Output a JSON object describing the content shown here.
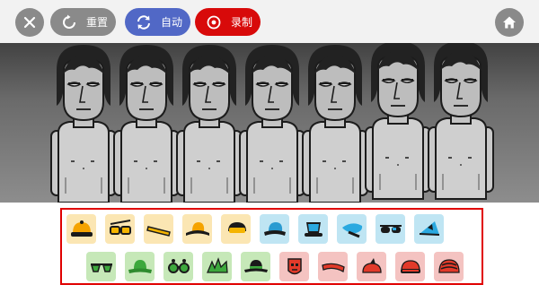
{
  "toolbar": {
    "reset_label": "重置",
    "auto_label": "自动",
    "record_label": "录制"
  },
  "colors": {
    "toolbar_bg": "#f2f2f2",
    "neutral_button": "#8a8a8a",
    "auto_button": "#5168c6",
    "record_button": "#d80a0a",
    "palette_border": "#e00000",
    "beats_tile": "#fbe6b3",
    "effects_tile": "#bfe5f3",
    "melodies_tile": "#c6e8b8",
    "voices_tile": "#f4c3c1"
  },
  "stage": {
    "character_count": 7
  },
  "palette": {
    "row1": [
      {
        "group": "beats",
        "icon": "yellow-cap-icon"
      },
      {
        "group": "beats",
        "icon": "yellow-sunglasses-icon"
      },
      {
        "group": "beats",
        "icon": "yellow-headband-icon"
      },
      {
        "group": "beats",
        "icon": "yellow-fedora-icon"
      },
      {
        "group": "beats",
        "icon": "yellow-visor-icon"
      },
      {
        "group": "effects",
        "icon": "blue-bowler-hat-icon"
      },
      {
        "group": "effects",
        "icon": "blue-top-hat-icon"
      },
      {
        "group": "effects",
        "icon": "blue-beret-icon"
      },
      {
        "group": "effects",
        "icon": "blue-sunglasses-icon"
      },
      {
        "group": "effects",
        "icon": "blue-pointy-cap-icon"
      }
    ],
    "row2": [
      {
        "group": "melodies",
        "icon": "green-sunglasses-icon"
      },
      {
        "group": "melodies",
        "icon": "green-hat-icon"
      },
      {
        "group": "melodies",
        "icon": "green-round-glasses-icon"
      },
      {
        "group": "melodies",
        "icon": "green-leaf-hair-icon"
      },
      {
        "group": "melodies",
        "icon": "green-fedora-icon"
      },
      {
        "group": "voices",
        "icon": "red-mask-icon"
      },
      {
        "group": "voices",
        "icon": "red-headband-icon"
      },
      {
        "group": "voices",
        "icon": "red-crest-hat-icon"
      },
      {
        "group": "voices",
        "icon": "red-beanie-icon"
      },
      {
        "group": "voices",
        "icon": "red-hair-icon"
      }
    ]
  }
}
